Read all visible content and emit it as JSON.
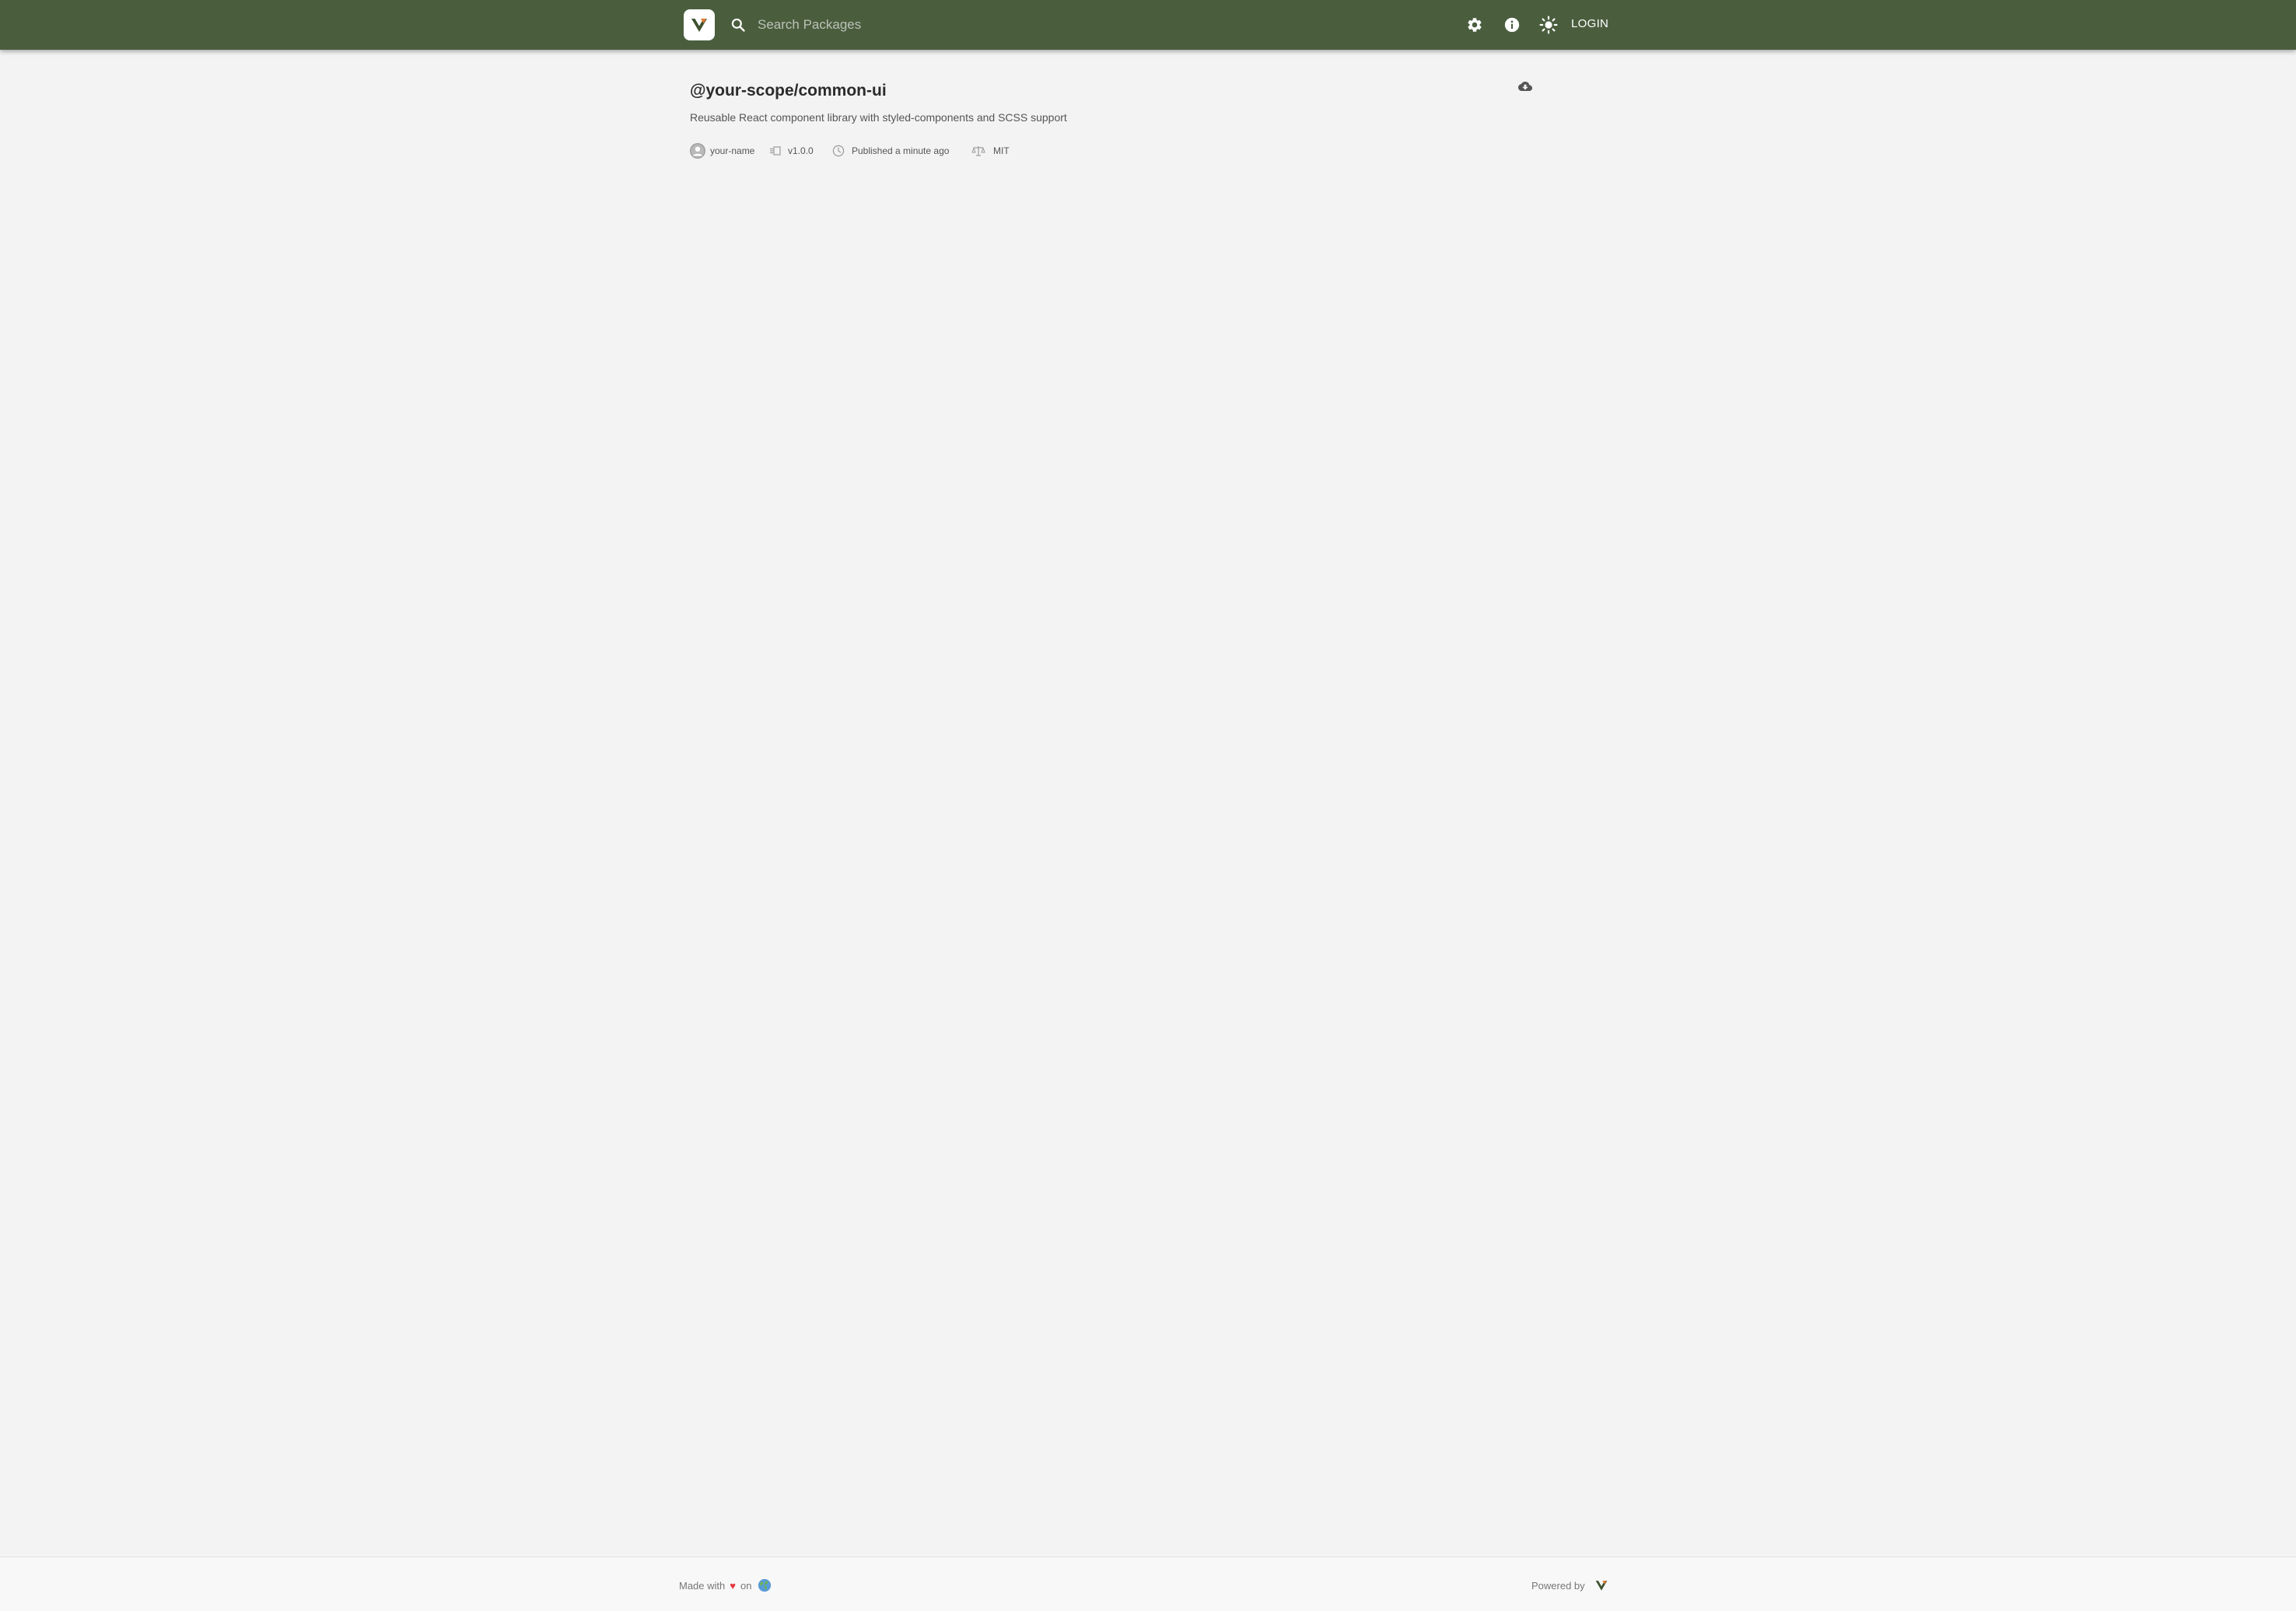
{
  "header": {
    "logo": "verdaccio-logo",
    "search": {
      "placeholder": "Search Packages",
      "value": ""
    },
    "icons": [
      "gear-icon",
      "info-icon",
      "sun-icon"
    ],
    "login_label": "LOGIN",
    "colors": {
      "bar": "#4a5e3e",
      "logo_bg": "#ffffff"
    }
  },
  "package": {
    "name": "@your-scope/common-ui",
    "description": "Reusable React component library with styled-components and SCSS support",
    "author": "your-name",
    "version": "v1.0.0",
    "published": "Published a minute ago",
    "license": "MIT",
    "download_icon": "cloud-download-icon"
  },
  "footer": {
    "made_with": "Made with",
    "on": "on",
    "heart_glyph": "♥",
    "powered_by": "Powered by",
    "icons": [
      "heart-icon",
      "globe-icon",
      "verdaccio-logo"
    ]
  },
  "colors": {
    "page_bg": "#f3f3f3",
    "heart": "#e5363d",
    "text_primary": "#2b2b2b",
    "text_secondary": "#555555"
  }
}
